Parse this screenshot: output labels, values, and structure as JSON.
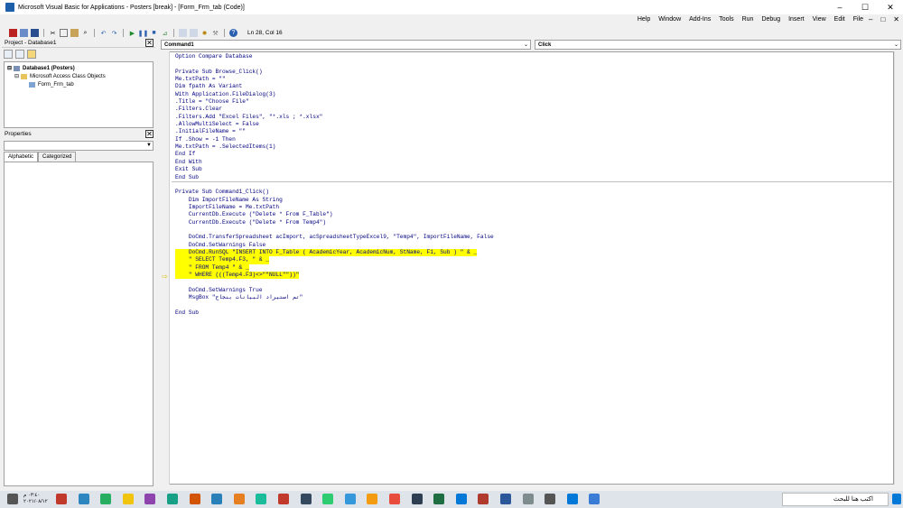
{
  "window": {
    "title": "Microsoft Visual Basic for Applications - Posters [break] - [Form_Frm_tab (Code)]"
  },
  "window_buttons": [
    "–",
    "☐",
    "✕"
  ],
  "menubar": {
    "items": [
      "Help",
      "Window",
      "Add-Ins",
      "Tools",
      "Run",
      "Debug",
      "Insert",
      "View",
      "Edit",
      "File"
    ],
    "mdi_buttons": [
      "–",
      "□",
      "✕"
    ]
  },
  "toolbar": {
    "cursor_position": "Ln 28, Col 16"
  },
  "project": {
    "title": "Project - Database1",
    "close": "✕",
    "tree": [
      {
        "label": "Database1 (Posters)",
        "level": 0,
        "bold": true
      },
      {
        "label": "Microsoft Access Class Objects",
        "level": 1,
        "bold": false
      },
      {
        "label": "Form_Frm_tab",
        "level": 2,
        "bold": false
      }
    ]
  },
  "properties": {
    "title": "Properties",
    "close": "✕",
    "tabs": [
      "Alphabetic",
      "Categorized"
    ]
  },
  "code": {
    "object_combo": "Command1",
    "procedure_combo": "Click",
    "lines": [
      "Option Compare Database",
      "",
      "Private Sub Browse_Click()",
      "Me.txtPath = \"\"",
      "Dim fpath As Variant",
      "With Application.FileDialog(3)",
      ".Title = \"Choose File\"",
      ".Filters.Clear",
      ".Filters.Add \"Excel Files\", \"*.xls ; *.xlsx\"",
      ".AllowMultiSelect = False",
      ".InitialFileName = \"\"",
      "If .Show = -1 Then",
      "Me.txtPath = .SelectedItems(1)",
      "End If",
      "End With",
      "Exit Sub",
      "End Sub",
      "",
      "Private Sub Command1_Click()",
      "    Dim ImportFileName As String",
      "    ImportFileName = Me.txtPath",
      "    CurrentDb.Execute (\"Delete * From F_Table\")",
      "    CurrentDb.Execute (\"Delete * From Temp4\")",
      "",
      "    DoCmd.TransferSpreadsheet acImport, acSpreadsheetTypeExcel9, \"Temp4\", ImportFileName, False",
      "    DoCmd.SetWarnings False",
      "    DoCmd.RunSQL \"INSERT INTO F_Table ( AcademicYear, AcademicNum, StName, F1, Sub ) \" & _",
      "    \" SELECT Temp4.F3, \" & _",
      "    \" FROM Temp4 \" & _",
      "    \" WHERE (((Temp4.F3)<>\"\"NULL\"\"))\"",
      "",
      "    DoCmd.SetWarnings True",
      "    MsgBox \"تم استيراد البيانات بنجاح\"",
      "",
      "End Sub"
    ],
    "highlighted_lines": [
      26,
      27,
      28,
      29
    ]
  },
  "taskbar": {
    "search_placeholder": "اكتب هنا للبحث",
    "clock_time": "٠٣:٤٠ م",
    "clock_date": "٢٠٢١/٠٨/١٢",
    "icon_colors": [
      "#c0392b",
      "#2e86c1",
      "#27ae60",
      "#f1c40f",
      "#8e44ad",
      "#16a085",
      "#d35400",
      "#2980b9",
      "#e67e22",
      "#1abc9c",
      "#c0392b",
      "#34495e",
      "#2ecc71",
      "#3498db",
      "#f39c12",
      "#e74c3c",
      "#2c3e50",
      "#1f6e43",
      "#0078d7",
      "#b03a2e",
      "#2b579a",
      "#7f8c8d",
      "#555555",
      "#0078d7",
      "#3a7bd5"
    ]
  }
}
